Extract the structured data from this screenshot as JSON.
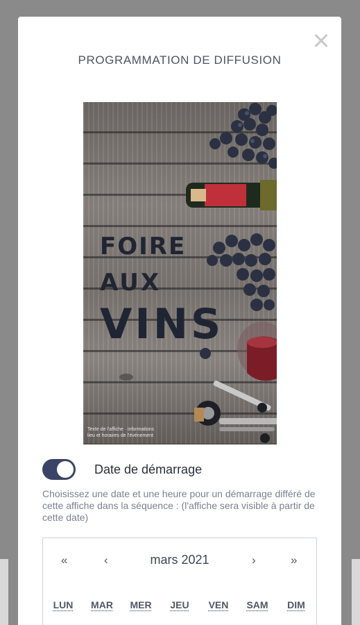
{
  "modal": {
    "title": "PROGRAMMATION DE DIFFUSION"
  },
  "poster": {
    "title_line1": "FOIRE",
    "title_line2": "AUX",
    "title_line3": "VINS",
    "small_line1": "Texte de l'affiche · informations",
    "small_line2": "lieu et horaires de l'événement"
  },
  "start_date": {
    "toggle_on": true,
    "label": "Date de démarrage",
    "help": "Choisissez une date et une heure pour un démarrage différé de cette affiche dans la séquence : (l'affiche sera visible à partir de cette date)"
  },
  "calendar": {
    "prev_year": "«",
    "prev_month": "‹",
    "month_label": "mars 2021",
    "next_month": "›",
    "next_year": "»",
    "weekdays": [
      "LUN",
      "MAR",
      "MER",
      "JEU",
      "VEN",
      "SAM",
      "DIM"
    ]
  },
  "colors": {
    "toggle_accent": "#3b4466",
    "poster_text": "#202533"
  }
}
